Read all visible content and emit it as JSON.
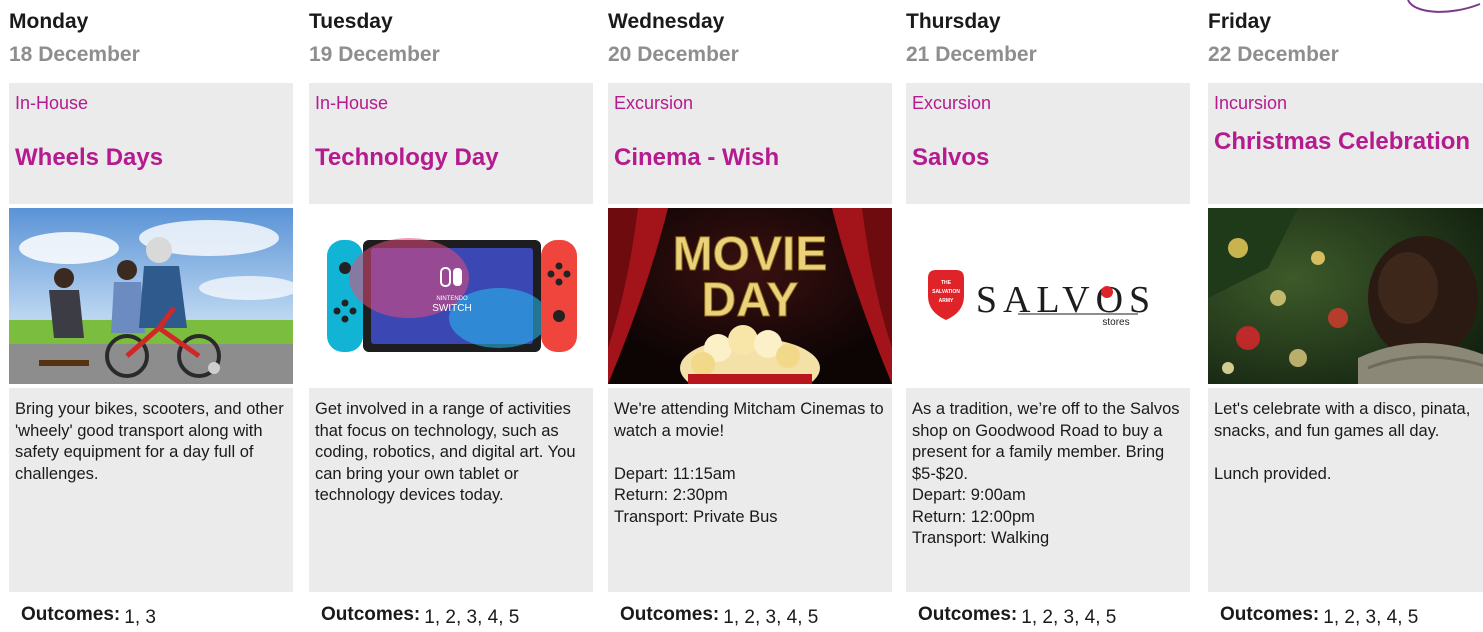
{
  "days": [
    {
      "day": "Monday",
      "date": "18 December",
      "category": "In-House",
      "title": "Wheels Days",
      "image_label": "",
      "description": "Bring your bikes, scooters, and other 'wheely' good transport along with safety equipment for a day full of challenges.",
      "outcomes_label": "Outcomes:",
      "outcomes": "1, 3"
    },
    {
      "day": "Tuesday",
      "date": "19 December",
      "category": "In-House",
      "title": "Technology Day",
      "image_label": "NINTENDO SWITCH",
      "description": "Get involved in a range of activities that focus on technology, such as coding, robotics, and digital art. You can bring your own tablet or technology devices today.",
      "outcomes_label": "Outcomes:",
      "outcomes": "1, 2, 3, 4, 5"
    },
    {
      "day": "Wednesday",
      "date": "20 December",
      "category": "Excursion",
      "title": "Cinema - Wish",
      "image_label": "MOVIE DAY",
      "description": "We're attending Mitcham Cinemas to watch a movie!\n\nDepart: 11:15am\nReturn: 2:30pm\nTransport: Private Bus",
      "outcomes_label": "Outcomes:",
      "outcomes": "1, 2, 3, 4, 5"
    },
    {
      "day": "Thursday",
      "date": "21 December",
      "category": "Excursion",
      "title": "Salvos",
      "image_label": "SALVOS stores",
      "description": "As a tradition, we’re off to the Salvos shop on Goodwood Road to buy a present for a family member. Bring $5-$20.\nDepart: 9:00am\nReturn: 12:00pm\nTransport: Walking",
      "outcomes_label": "Outcomes:",
      "outcomes": "1, 2, 3, 4, 5"
    },
    {
      "day": "Friday",
      "date": "22 December",
      "category": "Incursion",
      "title": "Christmas Celebration",
      "image_label": "",
      "description": "Let's celebrate with a disco, pinata, snacks, and fun games all day.\n\nLunch provided.",
      "outcomes_label": "Outcomes:",
      "outcomes": "1, 2, 3, 4, 5"
    }
  ],
  "switch_text": {
    "brand": "NINTENDO",
    "product": "SWITCH"
  },
  "movie_text": {
    "line1": "MOVIE",
    "line2": "DAY"
  },
  "salvos_text": {
    "army_a": "THE",
    "army_b": "SALVATION",
    "army_c": "ARMY",
    "word": "SALVOS",
    "sub": "stores"
  },
  "colors": {
    "accent": "#b51a8f",
    "card_bg": "#ebebeb",
    "date_grey": "#8e8e8e",
    "deco_purple": "#7a3a8c"
  },
  "icons": [
    "wheels-photo",
    "nintendo-switch-photo",
    "movie-day-photo",
    "salvos-logo",
    "christmas-photo"
  ]
}
